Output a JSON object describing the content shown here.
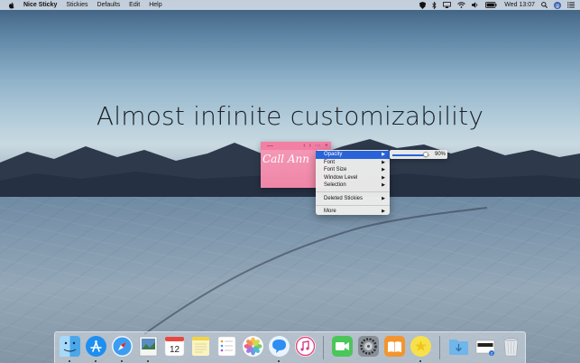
{
  "menubar": {
    "app_name": "Nice Sticky",
    "menus": [
      "Stickies",
      "Defaults",
      "Edit",
      "Help"
    ],
    "clock": "Wed 13:07"
  },
  "headline": "Almost infinite customizability",
  "sticky": {
    "note_text": "Call Ann",
    "color": "#f59ab8"
  },
  "context_menu": {
    "items": [
      {
        "label": "Opacity",
        "submenu": true,
        "active": true
      },
      {
        "label": "Font",
        "submenu": true
      },
      {
        "label": "Font Size",
        "submenu": true
      },
      {
        "label": "Window Level",
        "submenu": true
      },
      {
        "label": "Selection",
        "submenu": true
      },
      {
        "label": "Deleted Stickies",
        "submenu": true
      },
      {
        "label": "More",
        "submenu": true
      }
    ],
    "highlight_color": "#2a63d8"
  },
  "opacity_slider": {
    "value_label": "90%",
    "value": 0.9
  },
  "dock": {
    "items": [
      {
        "name": "finder-icon",
        "running": true
      },
      {
        "name": "app-store-icon",
        "running": true
      },
      {
        "name": "safari-icon",
        "running": true
      },
      {
        "name": "preview-icon",
        "running": true
      },
      {
        "name": "calendar-icon",
        "running": false,
        "text": "12"
      },
      {
        "name": "notes-icon",
        "running": false
      },
      {
        "name": "reminders-icon",
        "running": false
      },
      {
        "name": "photos-icon",
        "running": false
      },
      {
        "name": "messages-icon",
        "running": true
      },
      {
        "name": "itunes-icon",
        "running": false
      },
      {
        "name": "facetime-icon",
        "running": false
      },
      {
        "name": "system-preferences-icon",
        "running": false
      },
      {
        "name": "ibooks-icon",
        "running": false
      },
      {
        "name": "nice-sticky-icon",
        "running": true
      },
      {
        "name": "downloads-folder-icon",
        "running": false
      },
      {
        "name": "screenshot-stack-icon",
        "running": false
      },
      {
        "name": "trash-icon",
        "running": false
      }
    ]
  }
}
